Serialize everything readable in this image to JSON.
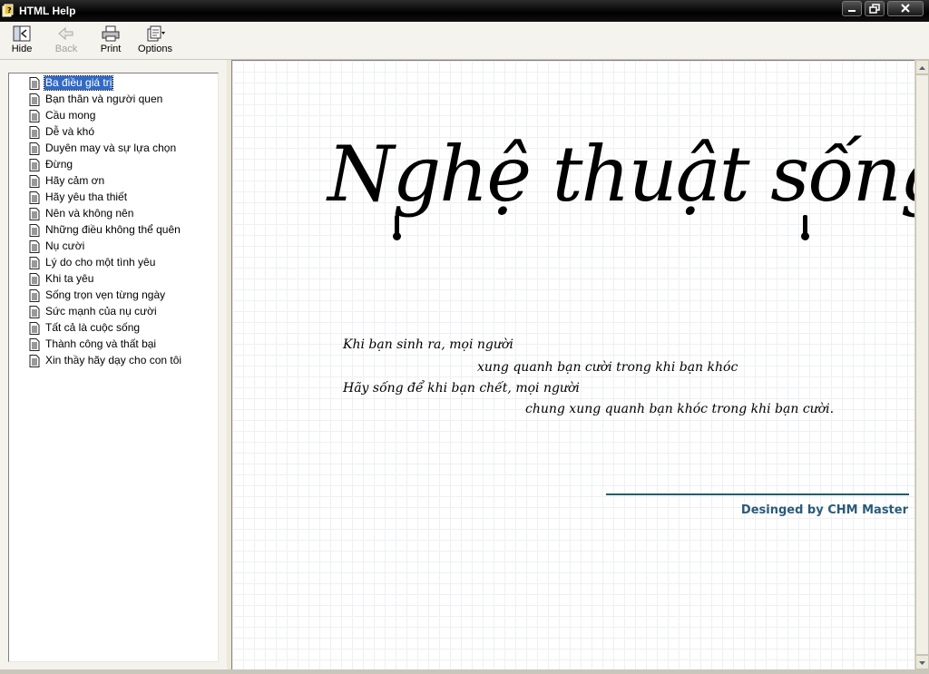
{
  "window": {
    "title": "HTML Help"
  },
  "toolbar": {
    "hide_label": "Hide",
    "back_label": "Back",
    "print_label": "Print",
    "options_label": "Options"
  },
  "tree": {
    "items": [
      {
        "label": "Ba điều giá trị",
        "selected": true
      },
      {
        "label": "Bạn thân và người quen"
      },
      {
        "label": "Cầu mong"
      },
      {
        "label": "Dễ và khó"
      },
      {
        "label": "Duyên may và sự lựa chọn"
      },
      {
        "label": "Đừng"
      },
      {
        "label": "Hãy cảm ơn"
      },
      {
        "label": "Hãy yêu tha thiết"
      },
      {
        "label": "Nên và không nên"
      },
      {
        "label": "Những điều không thể quên"
      },
      {
        "label": "Nụ cười"
      },
      {
        "label": "Lý do cho một tình yêu"
      },
      {
        "label": "Khi ta yêu"
      },
      {
        "label": "Sống trọn vẹn từng ngày"
      },
      {
        "label": "Sức mạnh của nụ cười"
      },
      {
        "label": "Tất cả là cuộc sống"
      },
      {
        "label": "Thành công và thất bại"
      },
      {
        "label": "Xin thầy hãy dạy cho con tôi"
      }
    ]
  },
  "content": {
    "headline": "Nghệ thuật sống",
    "poem": [
      "Khi bạn sinh ra, mọi người",
      "xung quanh bạn cười trong khi bạn khóc",
      "Hãy sống để khi bạn chết, mọi người",
      "chung xung quanh bạn khóc trong khi bạn cười."
    ],
    "credit": "Desinged by CHM Master"
  },
  "colors": {
    "selection": "#316ac5",
    "credit": "#2a5b79",
    "credit_rule": "#1f5f6b"
  }
}
